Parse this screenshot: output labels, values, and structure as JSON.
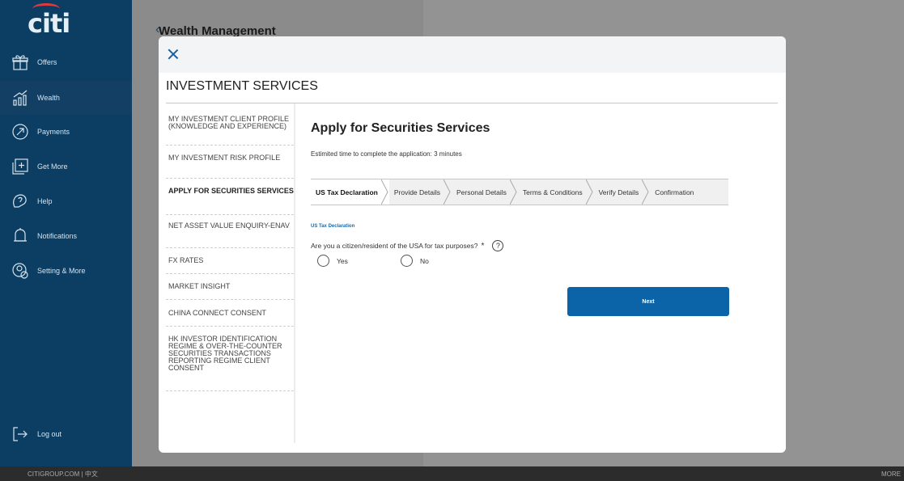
{
  "sidebar": {
    "logo": "citi",
    "items": [
      {
        "label": "Offers",
        "icon": "gift-icon"
      },
      {
        "label": "Wealth",
        "icon": "wealth-chart-icon"
      },
      {
        "label": "Payments",
        "icon": "payments-icon"
      },
      {
        "label": "Get More",
        "icon": "get-more-icon"
      },
      {
        "label": "Help",
        "icon": "help-icon"
      },
      {
        "label": "Notifications",
        "icon": "bell-icon"
      },
      {
        "label": "Setting & More",
        "icon": "settings-icon"
      }
    ],
    "logout": "Log out"
  },
  "background": {
    "title": "Wealth Management"
  },
  "modal": {
    "title": "INVESTMENT SERVICES",
    "menu": [
      "MY INVESTMENT CLIENT PROFILE (KNOWLEDGE AND EXPERIENCE)",
      "MY INVESTMENT RISK PROFILE",
      "APPLY FOR SECURITIES SERVICES",
      "NET ASSET VALUE ENQUIRY-ENAV",
      "FX RATES",
      "MARKET INSIGHT",
      "CHINA CONNECT CONSENT",
      "HK INVESTOR IDENTIFICATION REGIME & OVER-THE-COUNTER SECURITIES TRANSACTIONS REPORTING REGIME CLIENT CONSENT"
    ],
    "active_menu_index": 2,
    "content": {
      "heading": "Apply for Securities Services",
      "estimate": "Estimited time to complete the application: 3 minutes",
      "steps": [
        "US Tax Declaration",
        "Provide Details",
        "Personal Details",
        "Terms & Conditions",
        "Verify Details",
        "Confirmation"
      ],
      "section_label": "US Tax Declaration",
      "question": "Are you a citizen/resident of the USA for tax purposes?",
      "required_mark": "*",
      "help_glyph": "?",
      "option_yes": "Yes",
      "option_no": "No",
      "next_label": "Next"
    }
  },
  "footer": {
    "left": "CITIGROUP.COM  |  中文",
    "right": "MORE"
  }
}
